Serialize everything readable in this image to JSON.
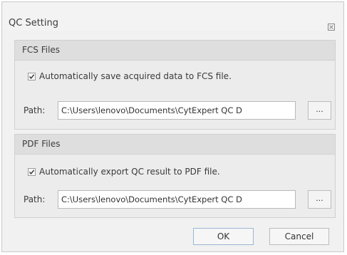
{
  "dialog": {
    "title": "QC Setting",
    "close_icon": "close-icon"
  },
  "fcs_section": {
    "title": "FCS Files",
    "auto_save_checked": true,
    "auto_save_label": "Automatically save acquired data to FCS file.",
    "path_label": "Path:",
    "path_value": "C:\\Users\\lenovo\\Documents\\CytExpert QC D",
    "browse_label": "..."
  },
  "pdf_section": {
    "title": "PDF Files",
    "auto_export_checked": true,
    "auto_export_label": "Automatically export QC result to PDF file.",
    "path_label": "Path:",
    "path_value": "C:\\Users\\lenovo\\Documents\\CytExpert QC D",
    "browse_label": "..."
  },
  "buttons": {
    "ok_label": "OK",
    "cancel_label": "Cancel"
  }
}
